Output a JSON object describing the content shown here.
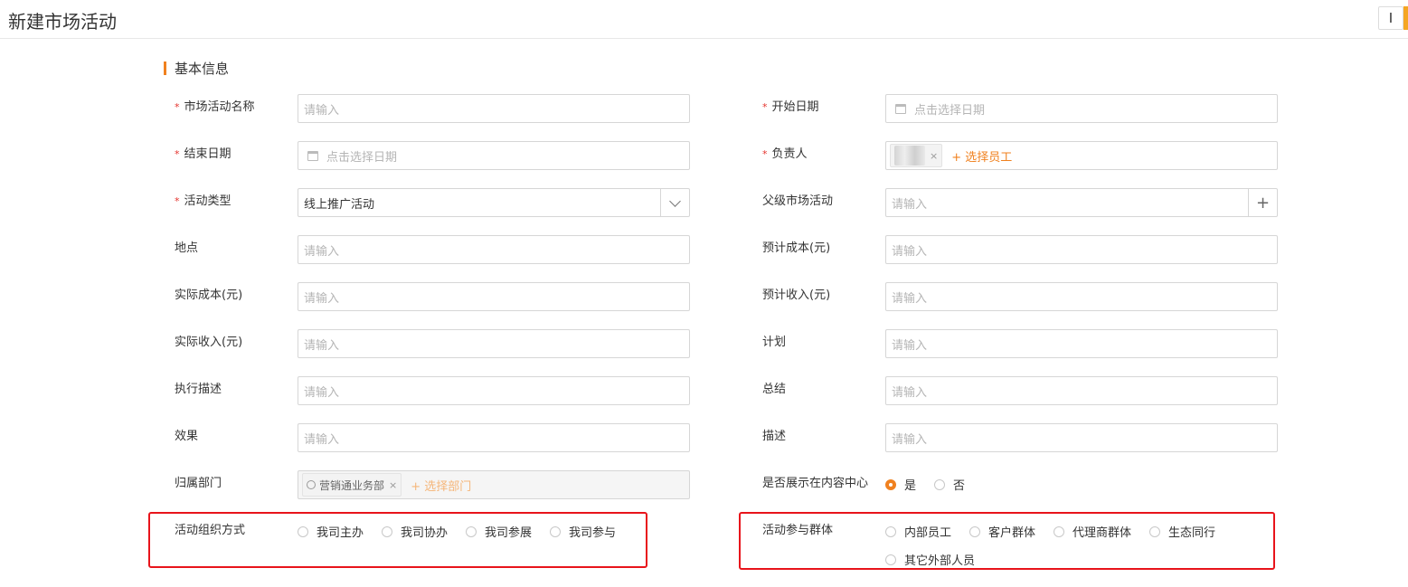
{
  "page_title": "新建市场活动",
  "corner_button": "I",
  "section_title": "基本信息",
  "colors": {
    "accent": "#f0811f",
    "required": "#e5332d",
    "highlight_box": "#e8141b"
  },
  "fields": {
    "activity_name": {
      "label": "市场活动名称",
      "placeholder": "请输入"
    },
    "start_date": {
      "label": "开始日期",
      "placeholder": "点击选择日期"
    },
    "end_date": {
      "label": "结束日期",
      "placeholder": "点击选择日期"
    },
    "owner": {
      "label": "负责人",
      "remove": "×",
      "add": "+ 选择员工"
    },
    "activity_type": {
      "label": "活动类型",
      "value": "线上推广活动"
    },
    "parent_activity": {
      "label": "父级市场活动",
      "placeholder": "请输入",
      "add": "+"
    },
    "location": {
      "label": "地点",
      "placeholder": "请输入"
    },
    "estimated_cost": {
      "label": "预计成本(元)",
      "placeholder": "请输入"
    },
    "actual_cost": {
      "label": "实际成本(元)",
      "placeholder": "请输入"
    },
    "estimated_income": {
      "label": "预计收入(元)",
      "placeholder": "请输入"
    },
    "actual_income": {
      "label": "实际收入(元)",
      "placeholder": "请输入"
    },
    "plan": {
      "label": "计划",
      "placeholder": "请输入"
    },
    "execution": {
      "label": "执行描述",
      "placeholder": "请输入"
    },
    "summary": {
      "label": "总结",
      "placeholder": "请输入"
    },
    "effect": {
      "label": "效果",
      "placeholder": "请输入"
    },
    "description": {
      "label": "描述",
      "placeholder": "请输入"
    },
    "department": {
      "label": "归属部门",
      "tag": "营销通业务部",
      "remove": "×",
      "add": "+ 选择部门"
    },
    "show_in_content_center": {
      "label": "是否展示在内容中心",
      "options": [
        "是",
        "否"
      ],
      "selected": "是"
    },
    "organize_mode": {
      "label": "活动组织方式",
      "options": [
        "我司主办",
        "我司协办",
        "我司参展",
        "我司参与"
      ]
    },
    "participant_group": {
      "label": "活动参与群体",
      "options": [
        "内部员工",
        "客户群体",
        "代理商群体",
        "生态同行",
        "其它外部人员"
      ]
    }
  }
}
